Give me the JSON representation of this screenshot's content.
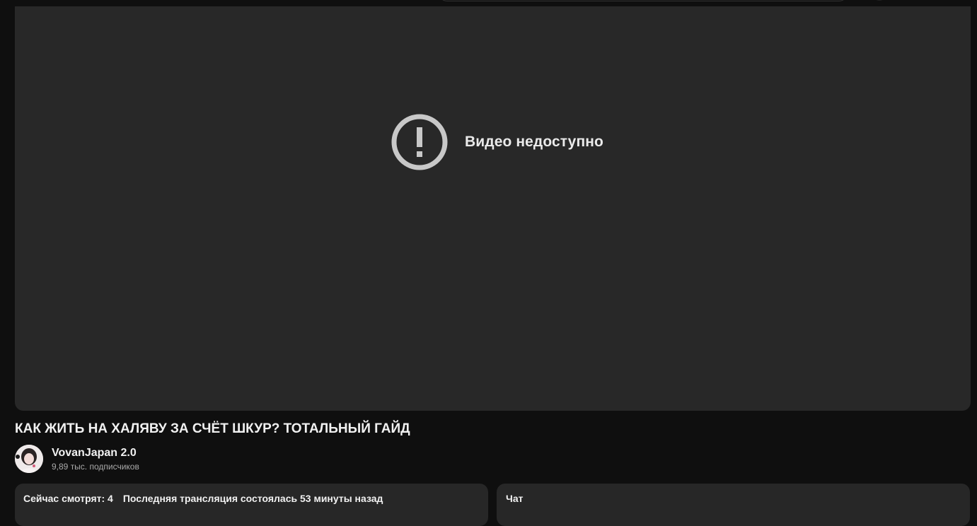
{
  "player": {
    "error_icon": "exclamation-circle-icon",
    "error_message": "Видео недоступно"
  },
  "video": {
    "title": "КАК ЖИТЬ НА ХАЛЯВУ ЗА СЧЁТ ШКУР? ТОТАЛЬНЫЙ ГАЙД"
  },
  "channel": {
    "name": "VovanJapan 2.0",
    "subscribers": "9,89 тыс. подписчиков"
  },
  "description": {
    "viewers": "Сейчас смотрят: 4",
    "last_stream": "Последняя трансляция состоялась 53 минуты назад"
  },
  "chat": {
    "label": "Чат"
  },
  "colors": {
    "background": "#0f0f0f",
    "player_bg": "#282828",
    "panel_bg": "#272727",
    "icon_color": "#c8c8c8"
  }
}
